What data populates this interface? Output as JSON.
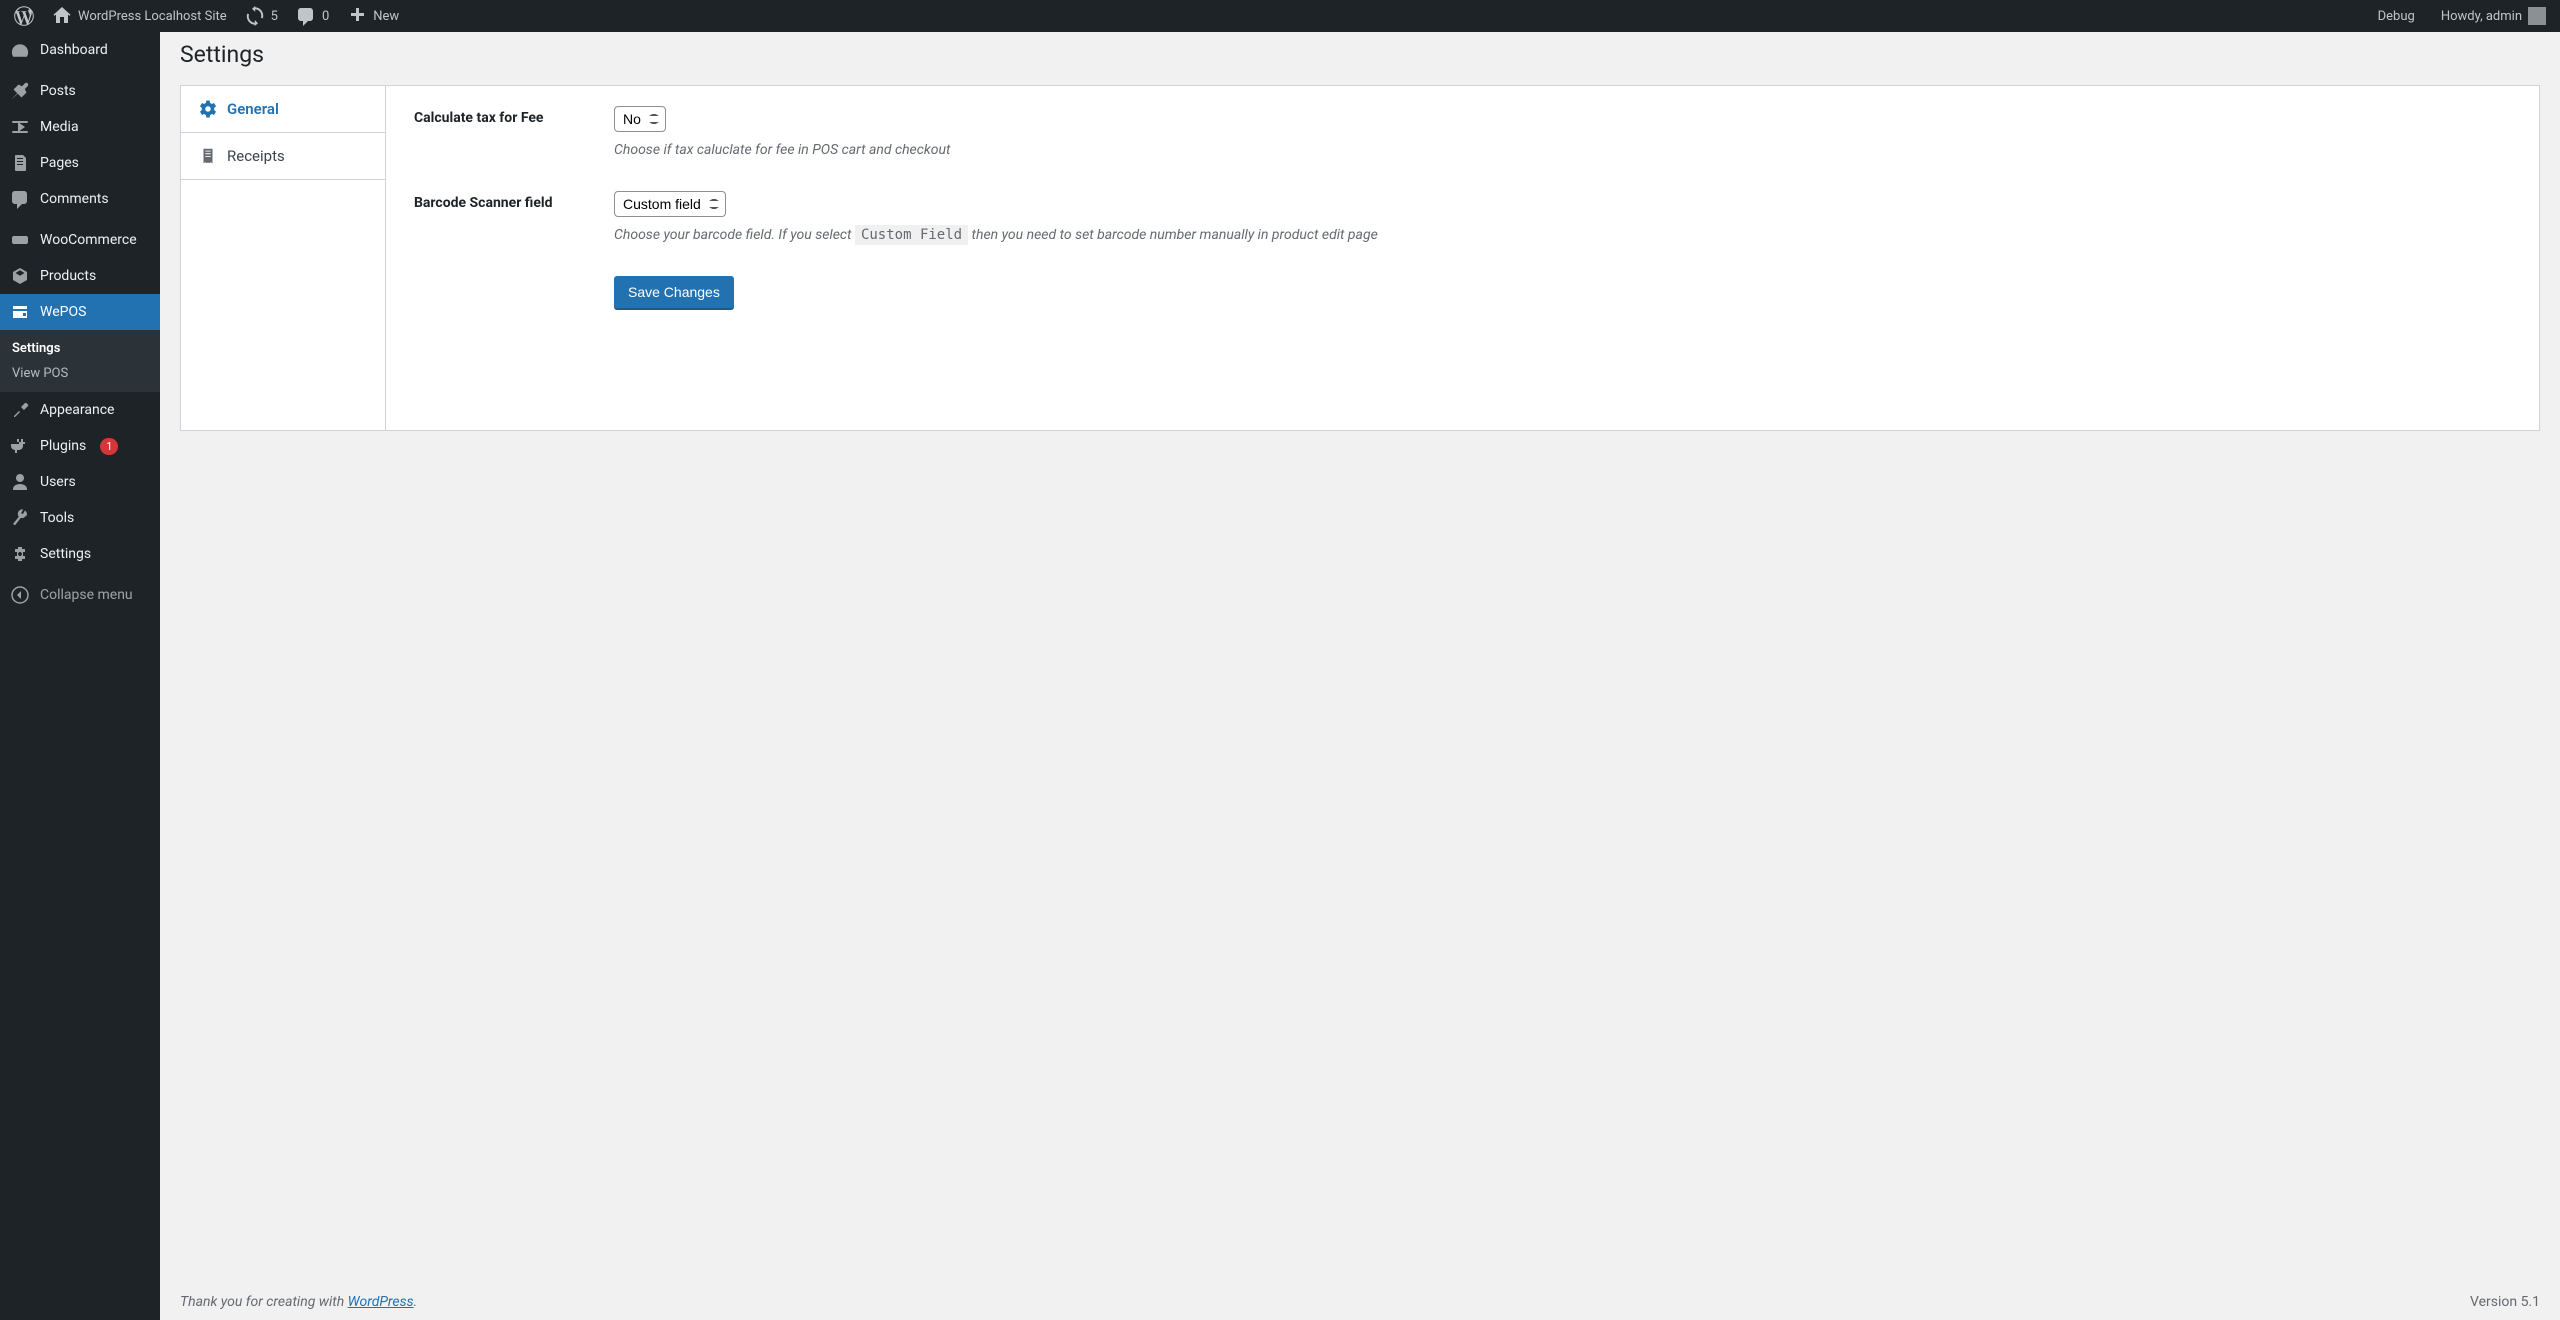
{
  "adminbar": {
    "site_name": "WordPress Localhost Site",
    "updates_count": "5",
    "comments_count": "0",
    "new_label": "New",
    "debug_label": "Debug",
    "howdy_label": "Howdy, admin"
  },
  "sidebar": {
    "items": [
      {
        "label": "Dashboard"
      },
      {
        "label": "Posts"
      },
      {
        "label": "Media"
      },
      {
        "label": "Pages"
      },
      {
        "label": "Comments"
      },
      {
        "label": "WooCommerce"
      },
      {
        "label": "Products"
      },
      {
        "label": "WePOS"
      },
      {
        "label": "Appearance"
      },
      {
        "label": "Plugins",
        "badge": "1"
      },
      {
        "label": "Users"
      },
      {
        "label": "Tools"
      },
      {
        "label": "Settings"
      }
    ],
    "submenu": [
      {
        "label": "Settings"
      },
      {
        "label": "View POS"
      }
    ],
    "collapse_label": "Collapse menu"
  },
  "page": {
    "title": "Settings",
    "tabs": [
      {
        "label": "General"
      },
      {
        "label": "Receipts"
      }
    ],
    "form": {
      "tax_label": "Calculate tax for Fee",
      "tax_value": "No",
      "tax_help": "Choose if tax caluclate for fee in POS cart and checkout",
      "barcode_label": "Barcode Scanner field",
      "barcode_value": "Custom field",
      "barcode_help_pre": "Choose your barcode field. If you select ",
      "barcode_help_code": "Custom Field",
      "barcode_help_post": " then you need to set barcode number manually in product edit page",
      "save_label": "Save Changes"
    }
  },
  "footer": {
    "thank_you_pre": "Thank you for creating with ",
    "wp_link": "WordPress",
    "thank_you_post": ".",
    "version": "Version 5.1"
  }
}
